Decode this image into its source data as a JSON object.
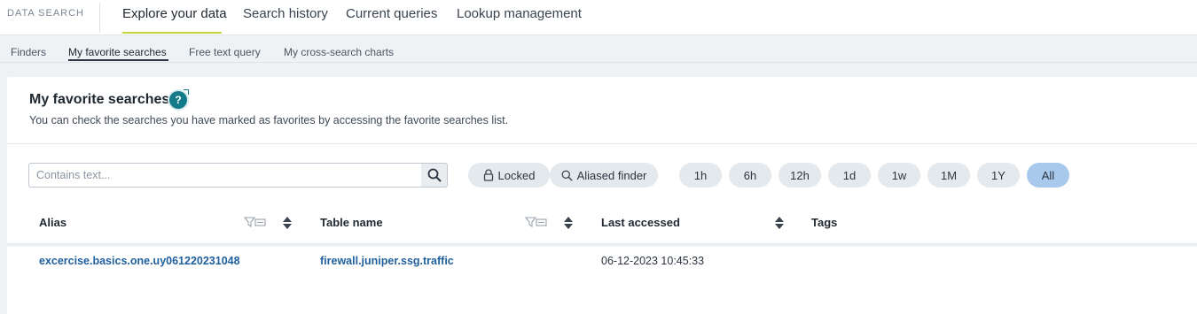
{
  "brand": "DATA SEARCH",
  "top_tabs": [
    {
      "label": "Explore your data",
      "active": true
    },
    {
      "label": "Search history",
      "active": false
    },
    {
      "label": "Current queries",
      "active": false
    },
    {
      "label": "Lookup management",
      "active": false
    }
  ],
  "sub_tabs": [
    {
      "label": "Finders",
      "active": false
    },
    {
      "label": "My favorite searches",
      "active": true
    },
    {
      "label": "Free text query",
      "active": false
    },
    {
      "label": "My cross-search charts",
      "active": false
    }
  ],
  "panel": {
    "title": "My favorite searches",
    "help_icon": "question-icon",
    "help_glyph": "?",
    "description": "You can check the searches you have marked as favorites by accessing the favorite searches list."
  },
  "search": {
    "placeholder": "Contains text...",
    "value": "",
    "icon": "search-icon"
  },
  "filters": [
    {
      "label": "Locked",
      "icon": "lock-icon"
    },
    {
      "label": "Aliased finder",
      "icon": "search-icon"
    }
  ],
  "time_ranges": [
    {
      "label": "1h",
      "active": false
    },
    {
      "label": "6h",
      "active": false
    },
    {
      "label": "12h",
      "active": false
    },
    {
      "label": "1d",
      "active": false
    },
    {
      "label": "1w",
      "active": false
    },
    {
      "label": "1M",
      "active": false
    },
    {
      "label": "1Y",
      "active": false
    },
    {
      "label": "All",
      "active": true
    }
  ],
  "table": {
    "columns": [
      {
        "label": "Alias",
        "filter_icon": "filter-icon",
        "sort_icon": "sort-icon"
      },
      {
        "label": "Table name",
        "filter_icon": "filter-icon",
        "sort_icon": "sort-icon"
      },
      {
        "label": "Last accessed",
        "sort_icon": "sort-icon"
      },
      {
        "label": "Tags"
      }
    ],
    "rows": [
      {
        "alias": "excercise.basics.one.uy061220231048",
        "table_name": "firewall.juniper.ssg.traffic",
        "last_accessed": "06-12-2023 10:45:33",
        "tags": ""
      }
    ]
  },
  "colors": {
    "accent_underline": "#c6d63a",
    "link": "#1f5f9e",
    "help_icon": "#127a88",
    "active_pill": "#a9c9ec"
  }
}
